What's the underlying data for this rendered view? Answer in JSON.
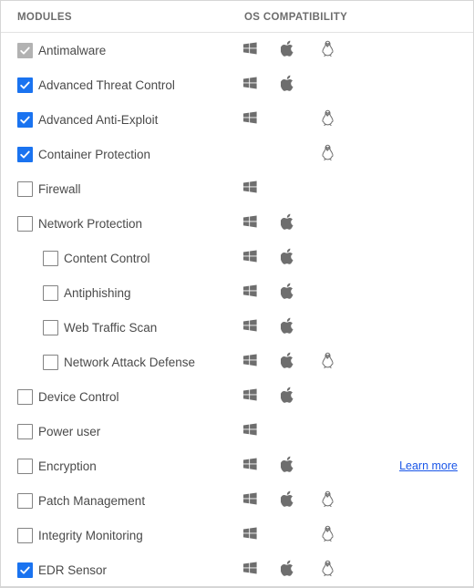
{
  "panel": {
    "columns": {
      "modules_header": "MODULES",
      "os_header": "OS COMPATIBILITY"
    },
    "colors": {
      "checkbox_checked": "#1a73f0",
      "checkbox_checked_disabled": "#b2b2b2",
      "checkbox_border": "#838383",
      "label_text": "#4a4a4a",
      "header_text": "#6d6d6d",
      "link": "#1a56e8",
      "panel_border": "#d6d6d6",
      "os_icon": "#6e6e6e"
    },
    "os_icons": [
      "windows-icon",
      "apple-icon",
      "linux-icon"
    ],
    "rows": [
      {
        "label": "Antimalware",
        "indent": 0,
        "checkbox_state": "checked-disabled",
        "os": {
          "windows": true,
          "mac": true,
          "linux": true
        },
        "link": null
      },
      {
        "label": "Advanced Threat Control",
        "indent": 0,
        "checkbox_state": "checked",
        "os": {
          "windows": true,
          "mac": true,
          "linux": false
        },
        "link": null
      },
      {
        "label": "Advanced Anti-Exploit",
        "indent": 0,
        "checkbox_state": "checked",
        "os": {
          "windows": true,
          "mac": false,
          "linux": true
        },
        "link": null
      },
      {
        "label": "Container Protection",
        "indent": 0,
        "checkbox_state": "checked",
        "os": {
          "windows": false,
          "mac": false,
          "linux": true
        },
        "link": null
      },
      {
        "label": "Firewall",
        "indent": 0,
        "checkbox_state": "unchecked",
        "os": {
          "windows": true,
          "mac": false,
          "linux": false
        },
        "link": null
      },
      {
        "label": "Network Protection",
        "indent": 0,
        "checkbox_state": "unchecked",
        "os": {
          "windows": true,
          "mac": true,
          "linux": false
        },
        "link": null
      },
      {
        "label": "Content Control",
        "indent": 1,
        "checkbox_state": "unchecked",
        "os": {
          "windows": true,
          "mac": true,
          "linux": false
        },
        "link": null
      },
      {
        "label": "Antiphishing",
        "indent": 1,
        "checkbox_state": "unchecked",
        "os": {
          "windows": true,
          "mac": true,
          "linux": false
        },
        "link": null
      },
      {
        "label": "Web Traffic Scan",
        "indent": 1,
        "checkbox_state": "unchecked",
        "os": {
          "windows": true,
          "mac": true,
          "linux": false
        },
        "link": null
      },
      {
        "label": "Network Attack Defense",
        "indent": 1,
        "checkbox_state": "unchecked",
        "os": {
          "windows": true,
          "mac": true,
          "linux": true
        },
        "link": null
      },
      {
        "label": "Device Control",
        "indent": 0,
        "checkbox_state": "unchecked",
        "os": {
          "windows": true,
          "mac": true,
          "linux": false
        },
        "link": null
      },
      {
        "label": "Power user",
        "indent": 0,
        "checkbox_state": "unchecked",
        "os": {
          "windows": true,
          "mac": false,
          "linux": false
        },
        "link": null
      },
      {
        "label": "Encryption",
        "indent": 0,
        "checkbox_state": "unchecked",
        "os": {
          "windows": true,
          "mac": true,
          "linux": false
        },
        "link": "Learn more"
      },
      {
        "label": "Patch Management",
        "indent": 0,
        "checkbox_state": "unchecked",
        "os": {
          "windows": true,
          "mac": true,
          "linux": true
        },
        "link": null
      },
      {
        "label": "Integrity Monitoring",
        "indent": 0,
        "checkbox_state": "unchecked",
        "os": {
          "windows": true,
          "mac": false,
          "linux": true
        },
        "link": null
      },
      {
        "label": "EDR Sensor",
        "indent": 0,
        "checkbox_state": "checked",
        "os": {
          "windows": true,
          "mac": true,
          "linux": true
        },
        "link": null
      }
    ]
  }
}
